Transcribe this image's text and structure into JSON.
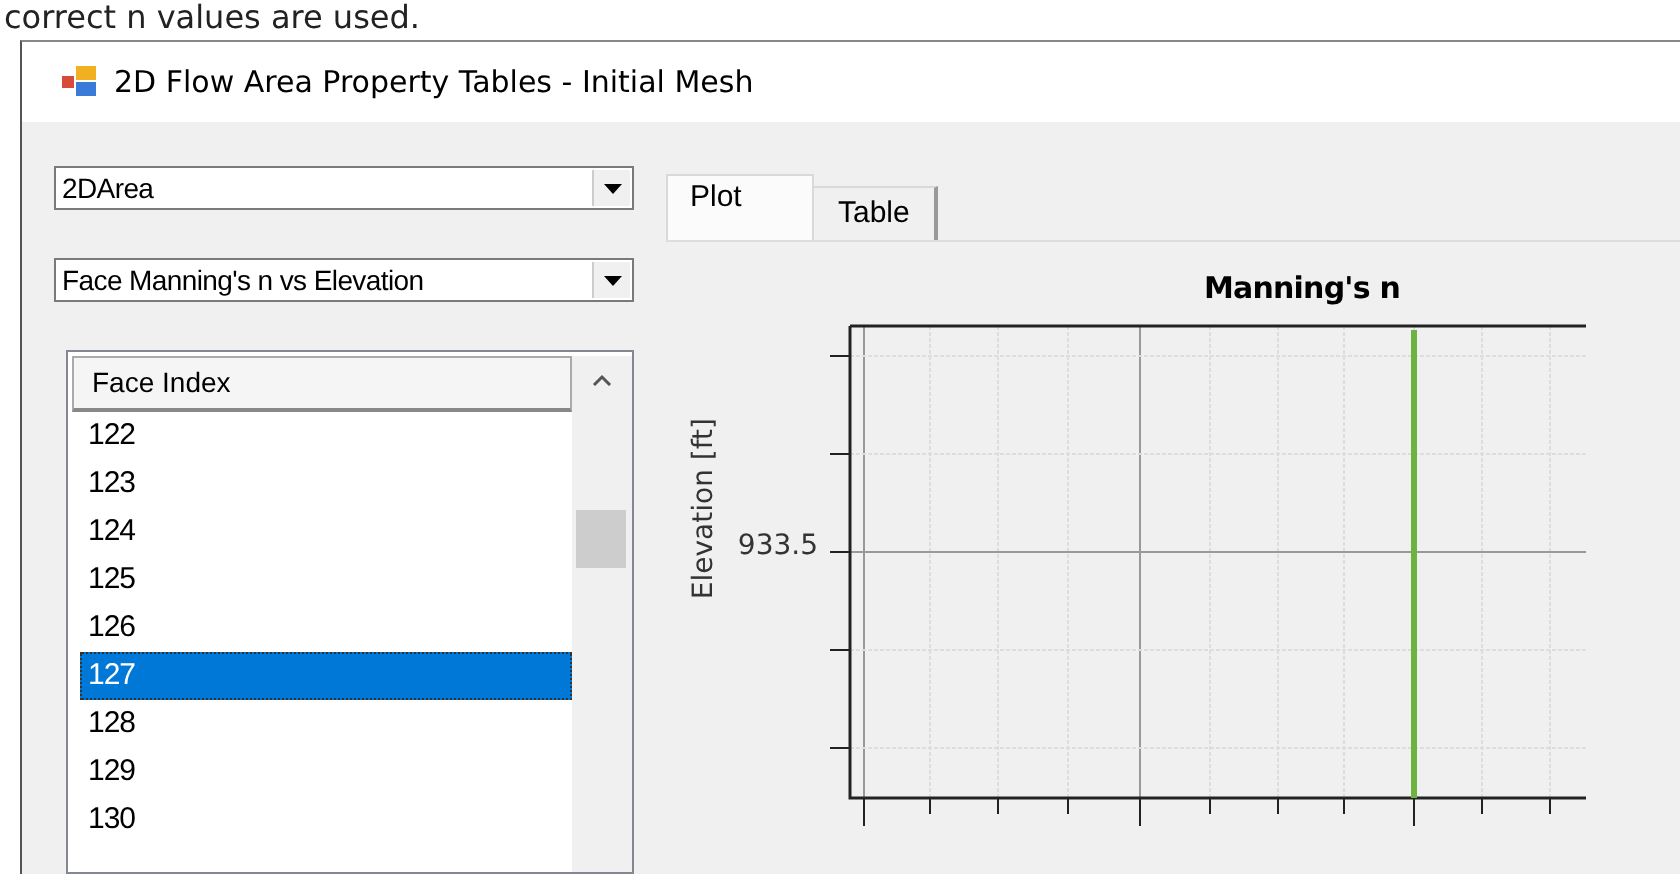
{
  "caption": "correct n values are used.",
  "window": {
    "title": "2D Flow Area Property Tables - Initial Mesh"
  },
  "area_select": {
    "value": "2DArea"
  },
  "table_select": {
    "value": "Face Manning's n vs Elevation"
  },
  "face_list": {
    "column": "Face Index",
    "rows": [
      {
        "label": "122",
        "selected": false
      },
      {
        "label": "123",
        "selected": false
      },
      {
        "label": "124",
        "selected": false
      },
      {
        "label": "125",
        "selected": false
      },
      {
        "label": "126",
        "selected": false
      },
      {
        "label": "127",
        "selected": true
      },
      {
        "label": "128",
        "selected": false
      },
      {
        "label": "129",
        "selected": false
      },
      {
        "label": "130",
        "selected": false
      }
    ]
  },
  "tabs": [
    {
      "label": "Plot",
      "selected": true
    },
    {
      "label": "Table",
      "selected": false
    }
  ],
  "plot": {
    "title": "Manning's n",
    "ylabel": "Elevation [ft]",
    "ytick_label": "933.5"
  }
}
